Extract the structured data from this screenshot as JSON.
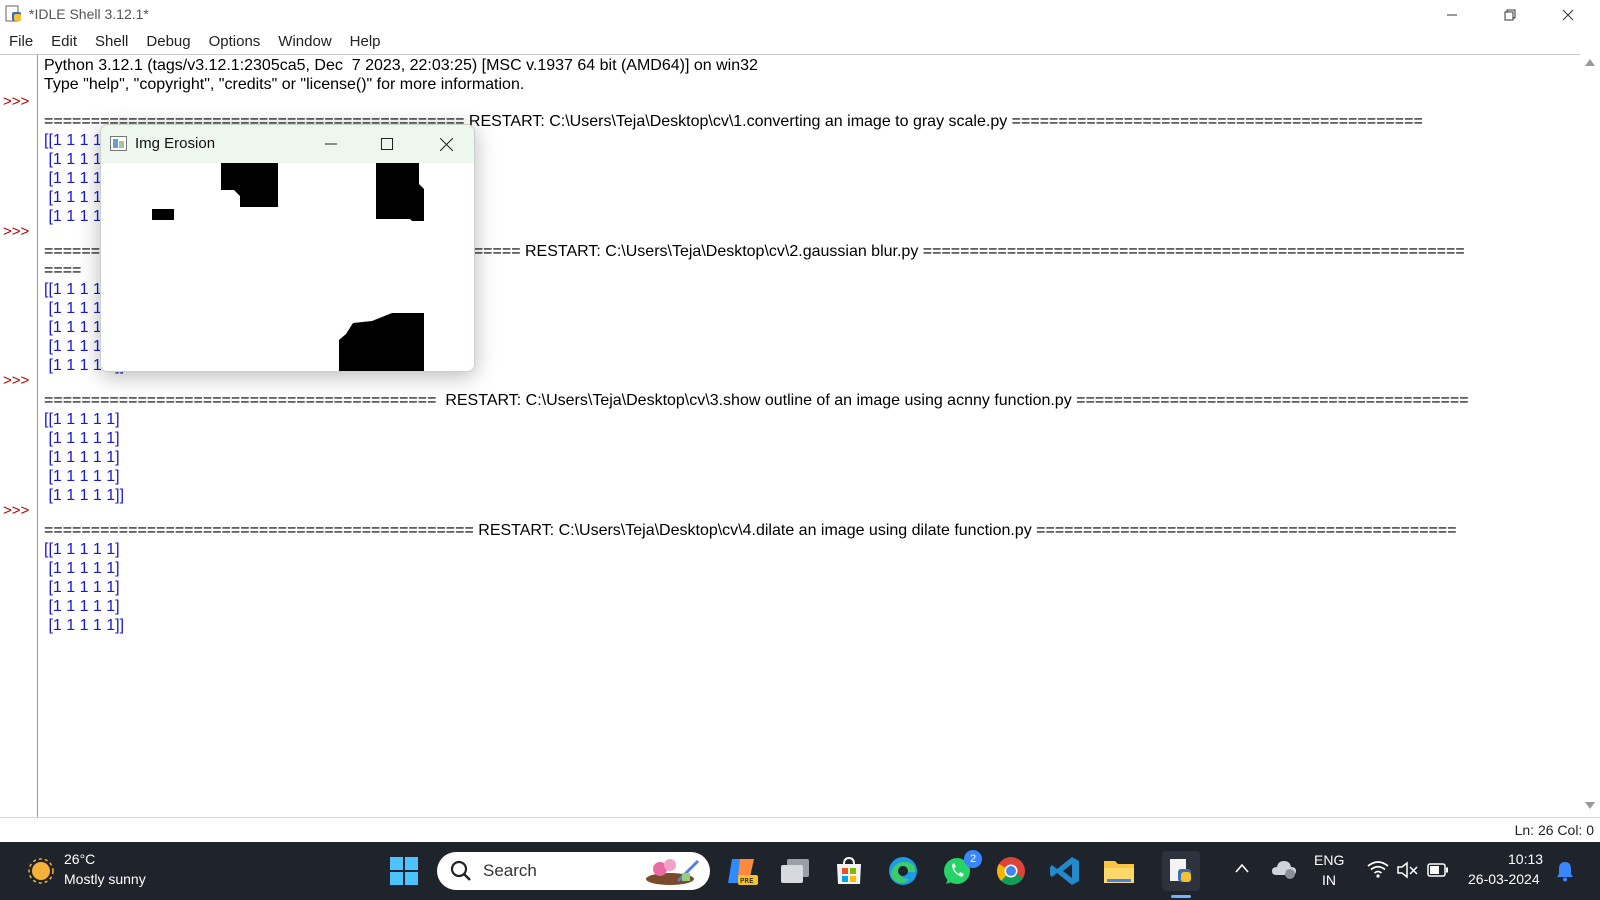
{
  "window": {
    "title": "*IDLE Shell 3.12.1*"
  },
  "menu": [
    "File",
    "Edit",
    "Shell",
    "Debug",
    "Options",
    "Window",
    "Help"
  ],
  "shell": {
    "prompt": ">>>",
    "banner": [
      "Python 3.12.1 (tags/v3.12.1:2305ca5, Dec  7 2023, 22:03:25) [MSC v.1937 64 bit (AMD64)] on win32",
      "Type \"help\", \"copyright\", \"credits\" or \"license()\" for more information."
    ],
    "restarts": [
      "============================================= RESTART: C:\\Users\\Teja\\Desktop\\cv\\1.converting an image to gray scale.py ============================================",
      "=================================================== RESTART: C:\\Users\\Teja\\Desktop\\cv\\2.gaussian blur.py ==========================================================",
      "==========================================  RESTART: C:\\Users\\Teja\\Desktop\\cv\\3.show outline of an image using acnny function.py ==========================================",
      "============================================== RESTART: C:\\Users\\Teja\\Desktop\\cv\\4.dilate an image using dilate function.py ============================================="
    ],
    "wrap_tail": "====",
    "matrix": {
      "first": "[[1 1 1 1 1]",
      "middle": " [1 1 1 1 1]",
      "last": " [1 1 1 1 1]]"
    }
  },
  "status": {
    "text": "Ln: 26   Col: 0"
  },
  "cv_window": {
    "title": "Img Erosion"
  },
  "taskbar": {
    "weather_temp": "26°C",
    "weather_desc": "Mostly sunny",
    "search_placeholder": "Search",
    "whatsapp_badge": "2",
    "lang_line1": "ENG",
    "lang_line2": "IN",
    "time": "10:13",
    "date": "26-03-2024"
  },
  "colors": {
    "prompt": "#b00000",
    "matrix_text": "#1a1acc",
    "taskbar_bg": "#1f232c"
  }
}
